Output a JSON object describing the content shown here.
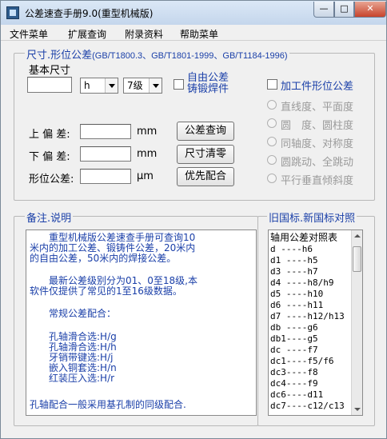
{
  "window": {
    "title": "公差速查手册9.0(重型机械版)",
    "minimize_symbol": "—",
    "maximize_symbol": "□",
    "close_symbol": "✕"
  },
  "menu": [
    "文件菜单",
    "扩展查询",
    "附录资料",
    "帮助菜单"
  ],
  "tolerance": {
    "group_title": "尺寸.形位公差",
    "group_standard": "(GB/T1800.3、GB/T1801-1999、GB/T1184-1996)",
    "basic_size_label": "基本尺寸",
    "basic_size_value": "",
    "fit_letter": "h",
    "grade": "7级",
    "free_tolerance_line1": "自由公差",
    "free_tolerance_line2": "铸锻焊件",
    "upper_label": "上 偏 差:",
    "lower_label": "下 偏 差:",
    "form_label": "形位公差:",
    "unit_mm_1": "mm",
    "unit_mm_2": "mm",
    "unit_um": "μm",
    "btn_query": "公差查询",
    "btn_clear": "尺寸清零",
    "btn_preferred": "优先配合",
    "workpiece_label": "加工件形位公差",
    "radios": [
      "直线度、平面度",
      "圆　度、圆柱度",
      "同轴度、对称度",
      "圆跳动、全跳动",
      "平行垂直倾斜度"
    ]
  },
  "notes": {
    "group_title": "备注.说明",
    "lines": [
      "　　重型机械版公差速查手册可查询10",
      "米内的加工公差、锻铸件公差，20米内",
      "的自由公差，50米内的焊接公差。",
      "",
      "　　最新公差级别分为01、0至18级,本",
      "软件仅提供了常见的1至16级数据。",
      "",
      "　　常规公差配合：",
      "",
      "　　孔轴滑合选:H/g",
      "　　孔轴滑合选:H/h",
      "　　牙销带键选:H/j",
      "　　嵌入铜套选:H/n",
      "　　红装压入选:H/r",
      "",
      " 孔轴配合一般采用基孔制的同级配合."
    ]
  },
  "mapping": {
    "group_title": "旧国标.新国标对照",
    "header": "轴用公差对照表",
    "items": [
      "d  ----h6",
      "d1 ----h5",
      "d3 ----h7",
      "d4 ----h8/h9",
      "d5 ----h10",
      "d6 ----h11",
      "d7 ----h12/h13",
      "db ----g6",
      "db1----g5",
      "dc ----f7",
      "dc1----f5/f6",
      "dc3----f8",
      "dc4----f9",
      "dc6----d11",
      "dc7----c12/c13"
    ]
  }
}
